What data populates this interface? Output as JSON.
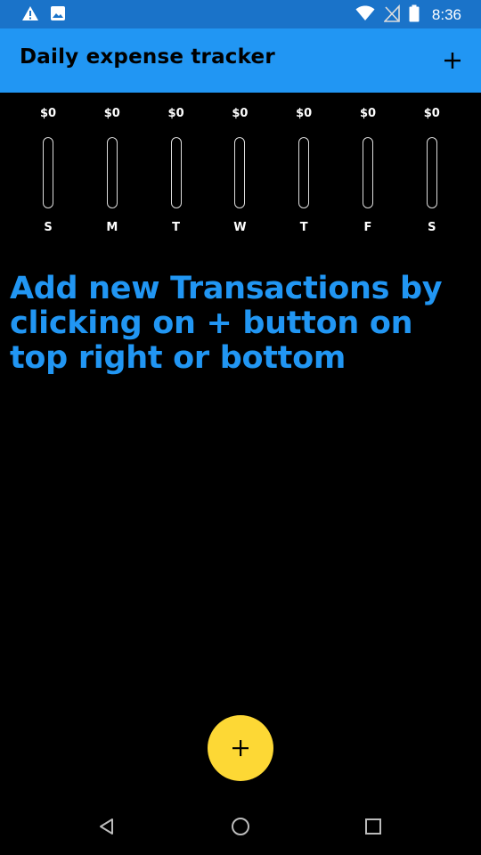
{
  "status_bar": {
    "time": "8:36",
    "icons": [
      "warning-icon",
      "image-icon",
      "wifi-icon",
      "no-signal-icon",
      "battery-icon"
    ]
  },
  "app_bar": {
    "title": "Daily expense tracker",
    "action_icon": "add-icon"
  },
  "chart_data": {
    "type": "bar",
    "categories": [
      "S",
      "M",
      "T",
      "W",
      "T",
      "F",
      "S"
    ],
    "values": [
      0,
      0,
      0,
      0,
      0,
      0,
      0
    ],
    "value_labels": [
      "$0",
      "$0",
      "$0",
      "$0",
      "$0",
      "$0",
      "$0"
    ],
    "ylim": [
      0,
      1
    ]
  },
  "empty_message": "Add new Transactions by clicking on + button on top right or bottom",
  "fab": {
    "icon": "add-icon",
    "color": "#fdd835"
  },
  "nav_bar": {
    "icons": [
      "back-icon",
      "home-icon",
      "recents-icon"
    ]
  },
  "colors": {
    "status_bar": "#1a73c9",
    "app_bar": "#2196f3",
    "accent_text": "#2196f3",
    "background": "#000000"
  }
}
